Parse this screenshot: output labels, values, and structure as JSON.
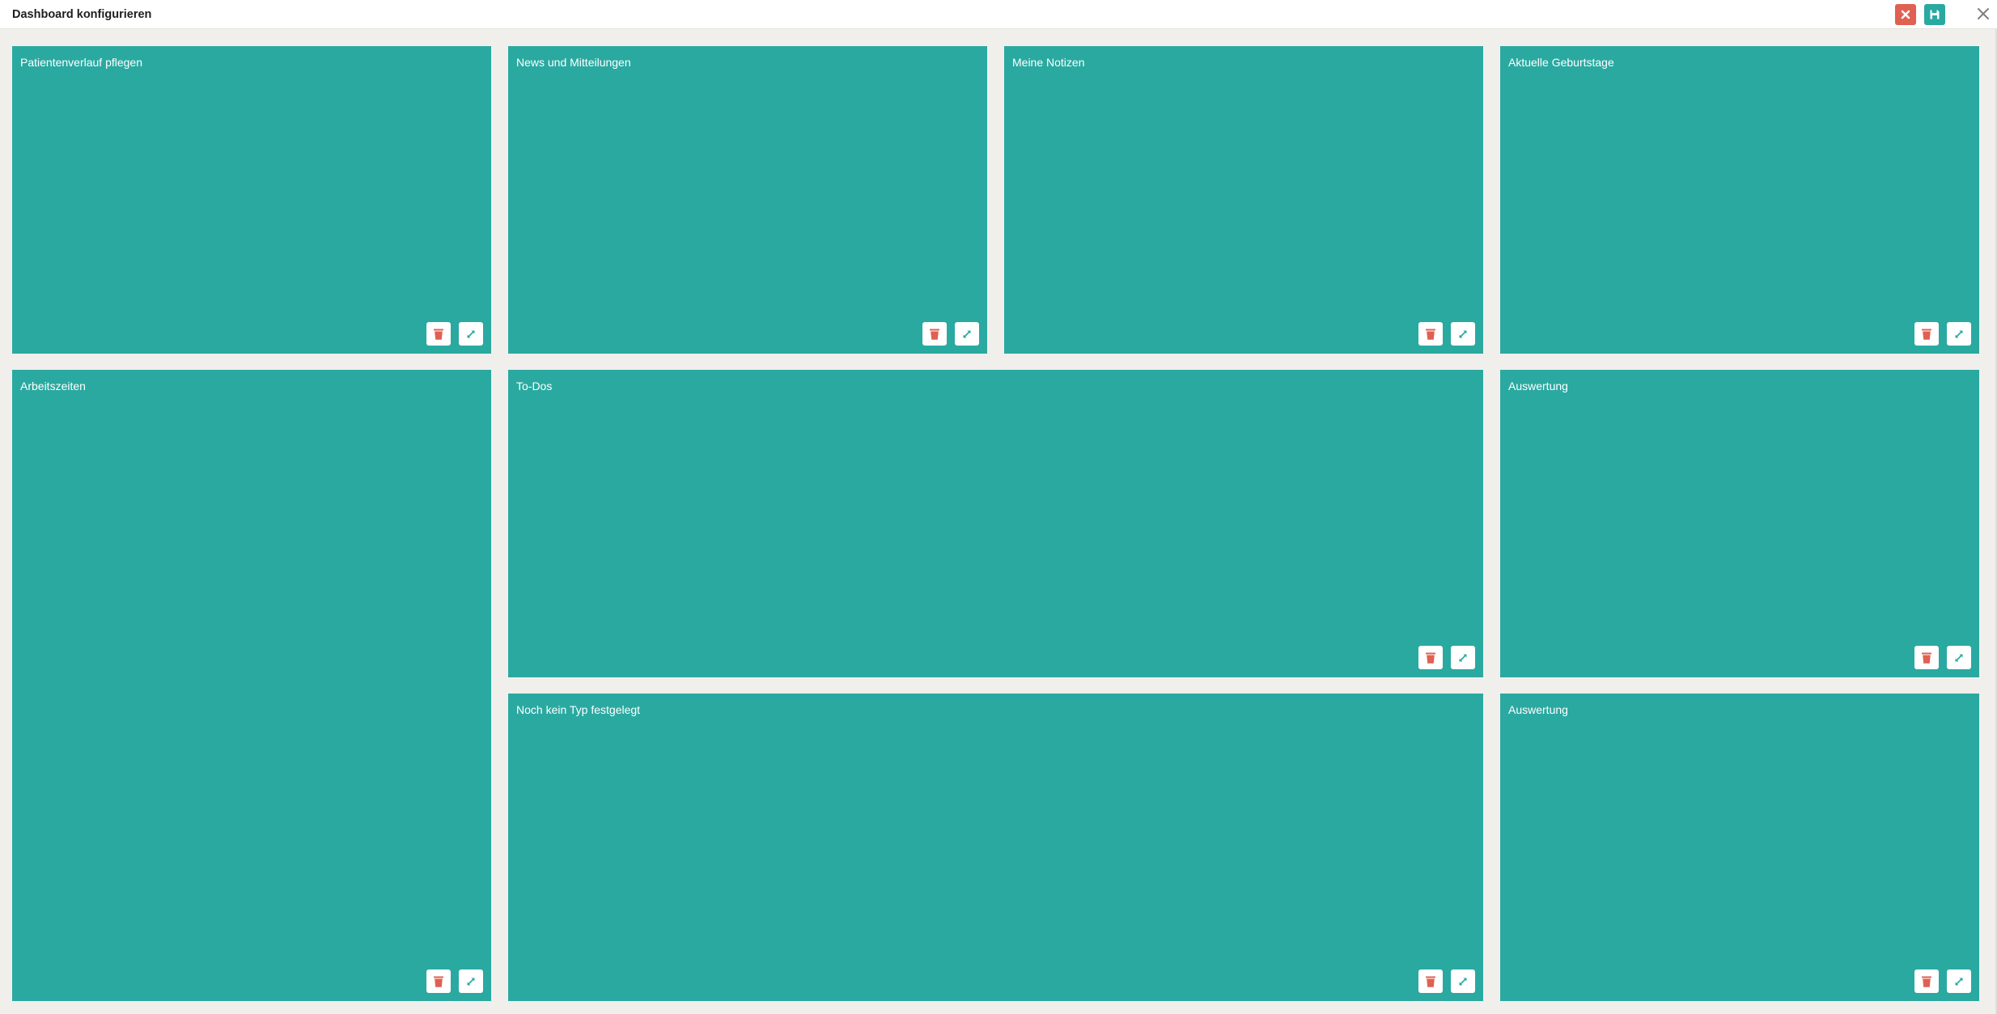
{
  "header": {
    "title": "Dashboard konfigurieren",
    "cancel_icon": "close-icon",
    "save_icon": "floppy-disk-icon",
    "close_icon": "close-x-icon"
  },
  "colors": {
    "tile": "#2aa9a1",
    "delete": "#e06052",
    "accent": "#2aa9a1",
    "background": "#f1efec"
  },
  "tiles": [
    {
      "title": "Patientenverlauf pflegen"
    },
    {
      "title": "News und Mitteilungen"
    },
    {
      "title": "Meine Notizen"
    },
    {
      "title": "Aktuelle Geburtstage"
    },
    {
      "title": "Arbeitszeiten"
    },
    {
      "title": "To-Dos"
    },
    {
      "title": "Auswertung"
    },
    {
      "title": "Noch kein Typ festgelegt"
    },
    {
      "title": "Auswertung"
    }
  ],
  "tile_actions": {
    "delete_icon": "trash-icon",
    "resize_icon": "expand-icon"
  }
}
